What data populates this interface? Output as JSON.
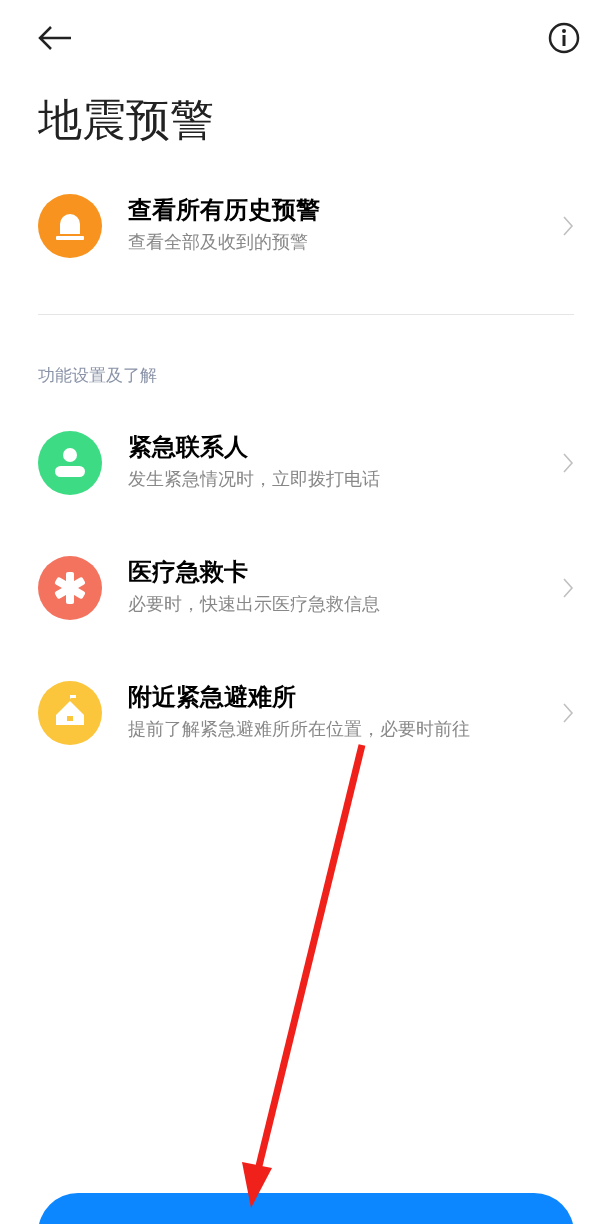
{
  "title": "地震预警",
  "history": {
    "kind": "siren",
    "color": "#f7931e",
    "title": "查看所有历史预警",
    "subtitle": "查看全部及收到的预警"
  },
  "section_header": "功能设置及了解",
  "items": [
    {
      "kind": "person",
      "color": "#3ddc84",
      "title": "紧急联系人",
      "subtitle": "发生紧急情况时，立即拨打电话"
    },
    {
      "kind": "asterisk",
      "color": "#f4735f",
      "title": "医疗急救卡",
      "subtitle": "必要时，快速出示医疗急救信息"
    },
    {
      "kind": "house",
      "color": "#fbc53c",
      "title": "附近紧急避难所",
      "subtitle": "提前了解紧急避难所所在位置，必要时前往"
    }
  ]
}
